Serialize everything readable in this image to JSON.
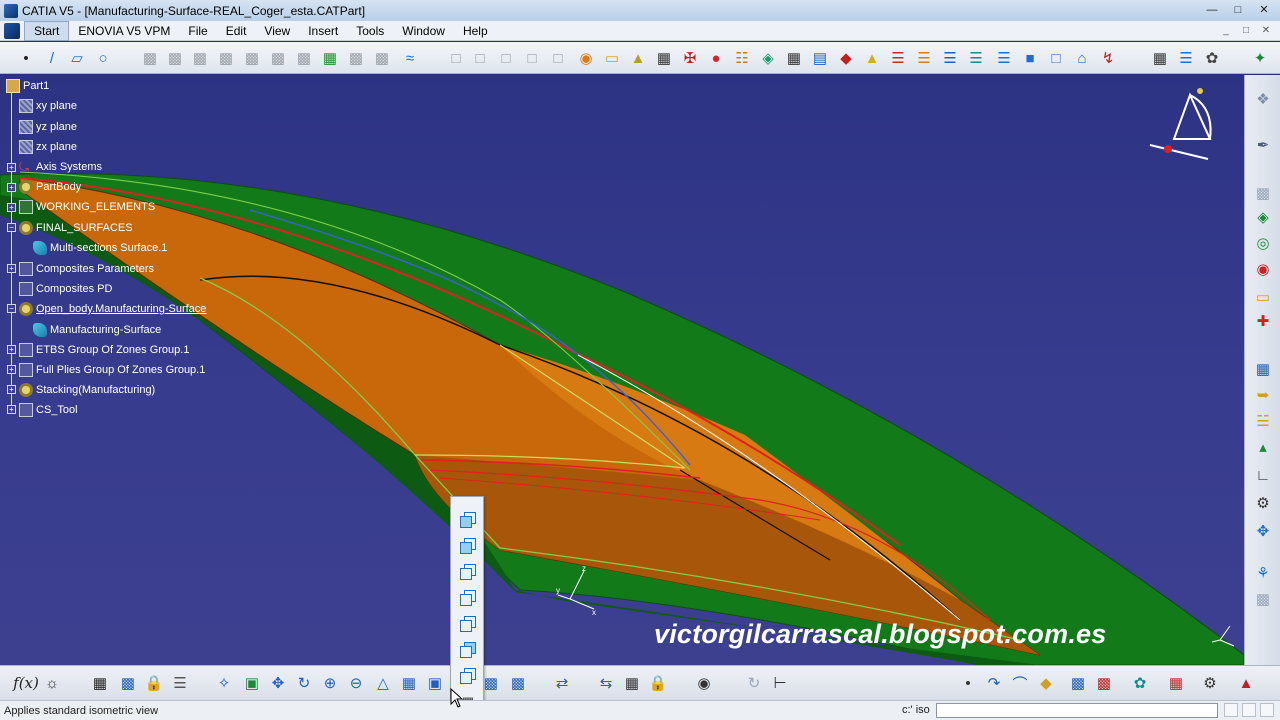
{
  "window": {
    "title": "CATIA V5 - [Manufacturing-Surface-REAL_Coger_esta.CATPart]",
    "minimize": "—",
    "restore": "□",
    "close": "✕"
  },
  "menubar": {
    "items": [
      "Start",
      "ENOVIA V5 VPM",
      "File",
      "Edit",
      "View",
      "Insert",
      "Tools",
      "Window",
      "Help"
    ]
  },
  "tree": {
    "root": "Part1",
    "nodes": [
      {
        "label": "xy plane",
        "icon": "plane-icon"
      },
      {
        "label": "yz plane",
        "icon": "plane-icon"
      },
      {
        "label": "zx plane",
        "icon": "plane-icon"
      },
      {
        "label": "Axis Systems",
        "icon": "axis-icon"
      },
      {
        "label": "PartBody",
        "icon": "gear-icon"
      },
      {
        "label": "WORKING_ELEMENTS",
        "icon": "geoset-icon"
      },
      {
        "label": "FINAL_SURFACES",
        "icon": "geoset-icon"
      },
      {
        "label": "Multi-sections Surface.1",
        "icon": "surface-icon"
      },
      {
        "label": "Composites Parameters",
        "icon": "parameters-icon"
      },
      {
        "label": "Composites PD",
        "icon": "composites-icon"
      },
      {
        "label": "Open_body.Manufacturing-Surface",
        "icon": "geoset-icon"
      },
      {
        "label": "Manufacturing-Surface",
        "icon": "surface-icon"
      },
      {
        "label": "ETBS Group Of Zones Group.1",
        "icon": "zones-icon"
      },
      {
        "label": "Full Plies Group Of Zones Group.1",
        "icon": "zones-icon"
      },
      {
        "label": "Stacking(Manufacturing)",
        "icon": "stacking-icon"
      },
      {
        "label": "CS_Tool",
        "icon": "tool-icon"
      }
    ]
  },
  "watermark": "victorgilcarrascal.blogspot.com.es",
  "statusbar": {
    "message": "Applies standard isometric view",
    "prompt": "c:' iso",
    "input_value": ""
  },
  "colors": {
    "background": "#2d3384",
    "surface_green": "#137a1a",
    "surface_orange": "#c96a08",
    "curve_red": "#e02020",
    "curve_green": "#7fd04a"
  }
}
